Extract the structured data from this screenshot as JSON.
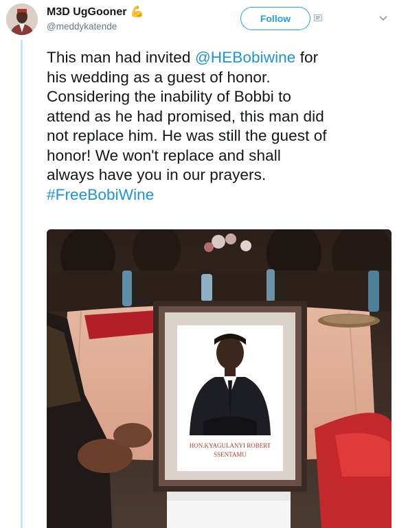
{
  "tweet": {
    "display_name": "M3D UgGooner",
    "handle": "@meddykatende",
    "follow_label": "Follow",
    "text_lines": [
      "This man had invited ",
      "his wedding as a guest of honor.",
      "Considering the inability of Bobbi to",
      "attend as he had promised, this man did",
      "not replace him. He was still the guest of",
      "honor! We won't replace and shall",
      "always have you in our prayers."
    ],
    "mention": "@HEBobiwine",
    "mention_suffix": " for",
    "hashtag": "#FreeBobiWine"
  },
  "photo": {
    "frame_caption_line1": "HON.KYAGULANYI ROBERT",
    "frame_caption_line2": "SSENTAMU"
  },
  "icons": {
    "verified_emoji": "flexed-biceps-icon",
    "add_user": "add-user-icon",
    "caret": "chevron-down-icon"
  },
  "colors": {
    "accent": "#1da1f2",
    "link": "#1b95e0",
    "text": "#14171a",
    "secondary": "#657786",
    "thread_line": "#c4e6f7"
  }
}
